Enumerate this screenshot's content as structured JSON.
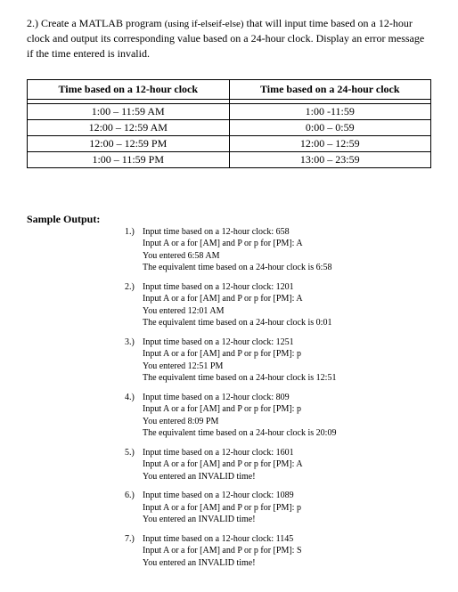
{
  "problem": {
    "number": "2.)",
    "text_before_hint": "Create a MATLAB program ",
    "hint": "(using if-elseif-else)",
    "text_after_hint": " that will input time based on a 12-hour clock and output its corresponding value based on a 24-hour clock.  Display an error message if the time entered is invalid."
  },
  "table": {
    "header12": "Time based on a 12-hour clock",
    "header24": "Time based on a 24-hour clock",
    "rows": [
      {
        "c12": "1:00 – 11:59 AM",
        "c24": "1:00 -11:59"
      },
      {
        "c12": "12:00 – 12:59 AM",
        "c24": "0:00 – 0:59"
      },
      {
        "c12": "12:00 – 12:59 PM",
        "c24": "12:00 – 12:59"
      },
      {
        "c12": "1:00 – 11:59 PM",
        "c24": "13:00 – 23:59"
      }
    ]
  },
  "sample_label": "Sample Output:",
  "outputs": [
    {
      "num": "1.)",
      "lines": [
        "Input time based on a 12-hour clock:  658",
        "Input A or a for [AM] and P or p for [PM]: A",
        "You entered 6:58 AM",
        "The equivalent time based on a 24-hour clock is 6:58"
      ]
    },
    {
      "num": "2.)",
      "lines": [
        "Input time based on a 12-hour clock:  1201",
        "Input A or a for [AM] and P or p for [PM]: A",
        "You entered 12:01 AM",
        "The equivalent time based on a 24-hour clock is 0:01"
      ]
    },
    {
      "num": "3.)",
      "lines": [
        "Input time based on a 12-hour clock:  1251",
        "Input A or a for [AM] and P or p for [PM]: p",
        "You entered 12:51 PM",
        "The equivalent time based on a 24-hour clock is 12:51"
      ]
    },
    {
      "num": "4.)",
      "lines": [
        "Input time based on a 12-hour clock:  809",
        "Input A or a for [AM] and P or p for [PM]: p",
        "You entered 8:09 PM",
        "The equivalent time based on a 24-hour clock is 20:09"
      ]
    },
    {
      "num": "5.)",
      "lines": [
        "Input time based on a 12-hour clock:  1601",
        "Input A or a for [AM] and P or p for [PM]: A",
        "You entered an INVALID time!"
      ]
    },
    {
      "num": "6.)",
      "lines": [
        "Input time based on a 12-hour clock:  1089",
        "Input A or a for [AM] and P or p for [PM]: p",
        "You entered an INVALID time!"
      ]
    },
    {
      "num": "7.)",
      "lines": [
        "Input time based on a 12-hour clock:  1145",
        "Input A or a for [AM] and P or p for [PM]: S",
        "You entered an INVALID time!"
      ]
    }
  ]
}
